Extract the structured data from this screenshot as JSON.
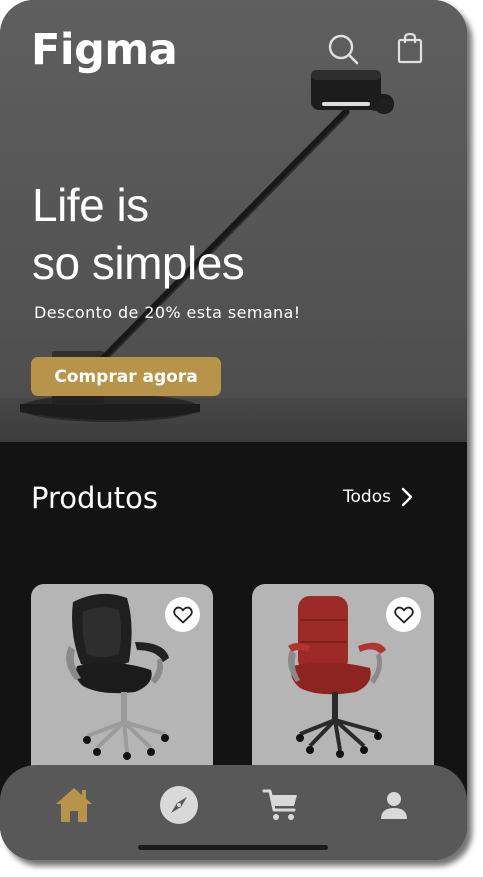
{
  "app": {
    "brand": "Figma"
  },
  "header": {
    "search_icon": "search-icon",
    "bag_icon": "shopping-bag-icon"
  },
  "hero": {
    "title_line1": "Life is",
    "title_line2": "so simples",
    "subtitle": "Desconto de 20% esta semana!",
    "cta_label": "Comprar agora",
    "image": "desk-lamp-image"
  },
  "products_section": {
    "title": "Produtos",
    "see_all_label": "Todos",
    "see_all_icon": "chevron-right-icon",
    "items": [
      {
        "image": "black-office-chair-image",
        "favorite_icon": "heart-icon"
      },
      {
        "image": "red-office-chair-image",
        "favorite_icon": "heart-icon"
      }
    ]
  },
  "bottom_nav": {
    "items": [
      {
        "icon": "home-icon",
        "active": true
      },
      {
        "icon": "compass-icon",
        "active": false
      },
      {
        "icon": "cart-icon",
        "active": false
      },
      {
        "icon": "user-icon",
        "active": false
      }
    ]
  },
  "colors": {
    "accent": "#b8934a",
    "hero_bg": "#555555",
    "page_bg": "#131313",
    "card_bg": "#b5b5b5",
    "nav_bg": "#585858",
    "nav_icon": "#d9d9d9"
  }
}
